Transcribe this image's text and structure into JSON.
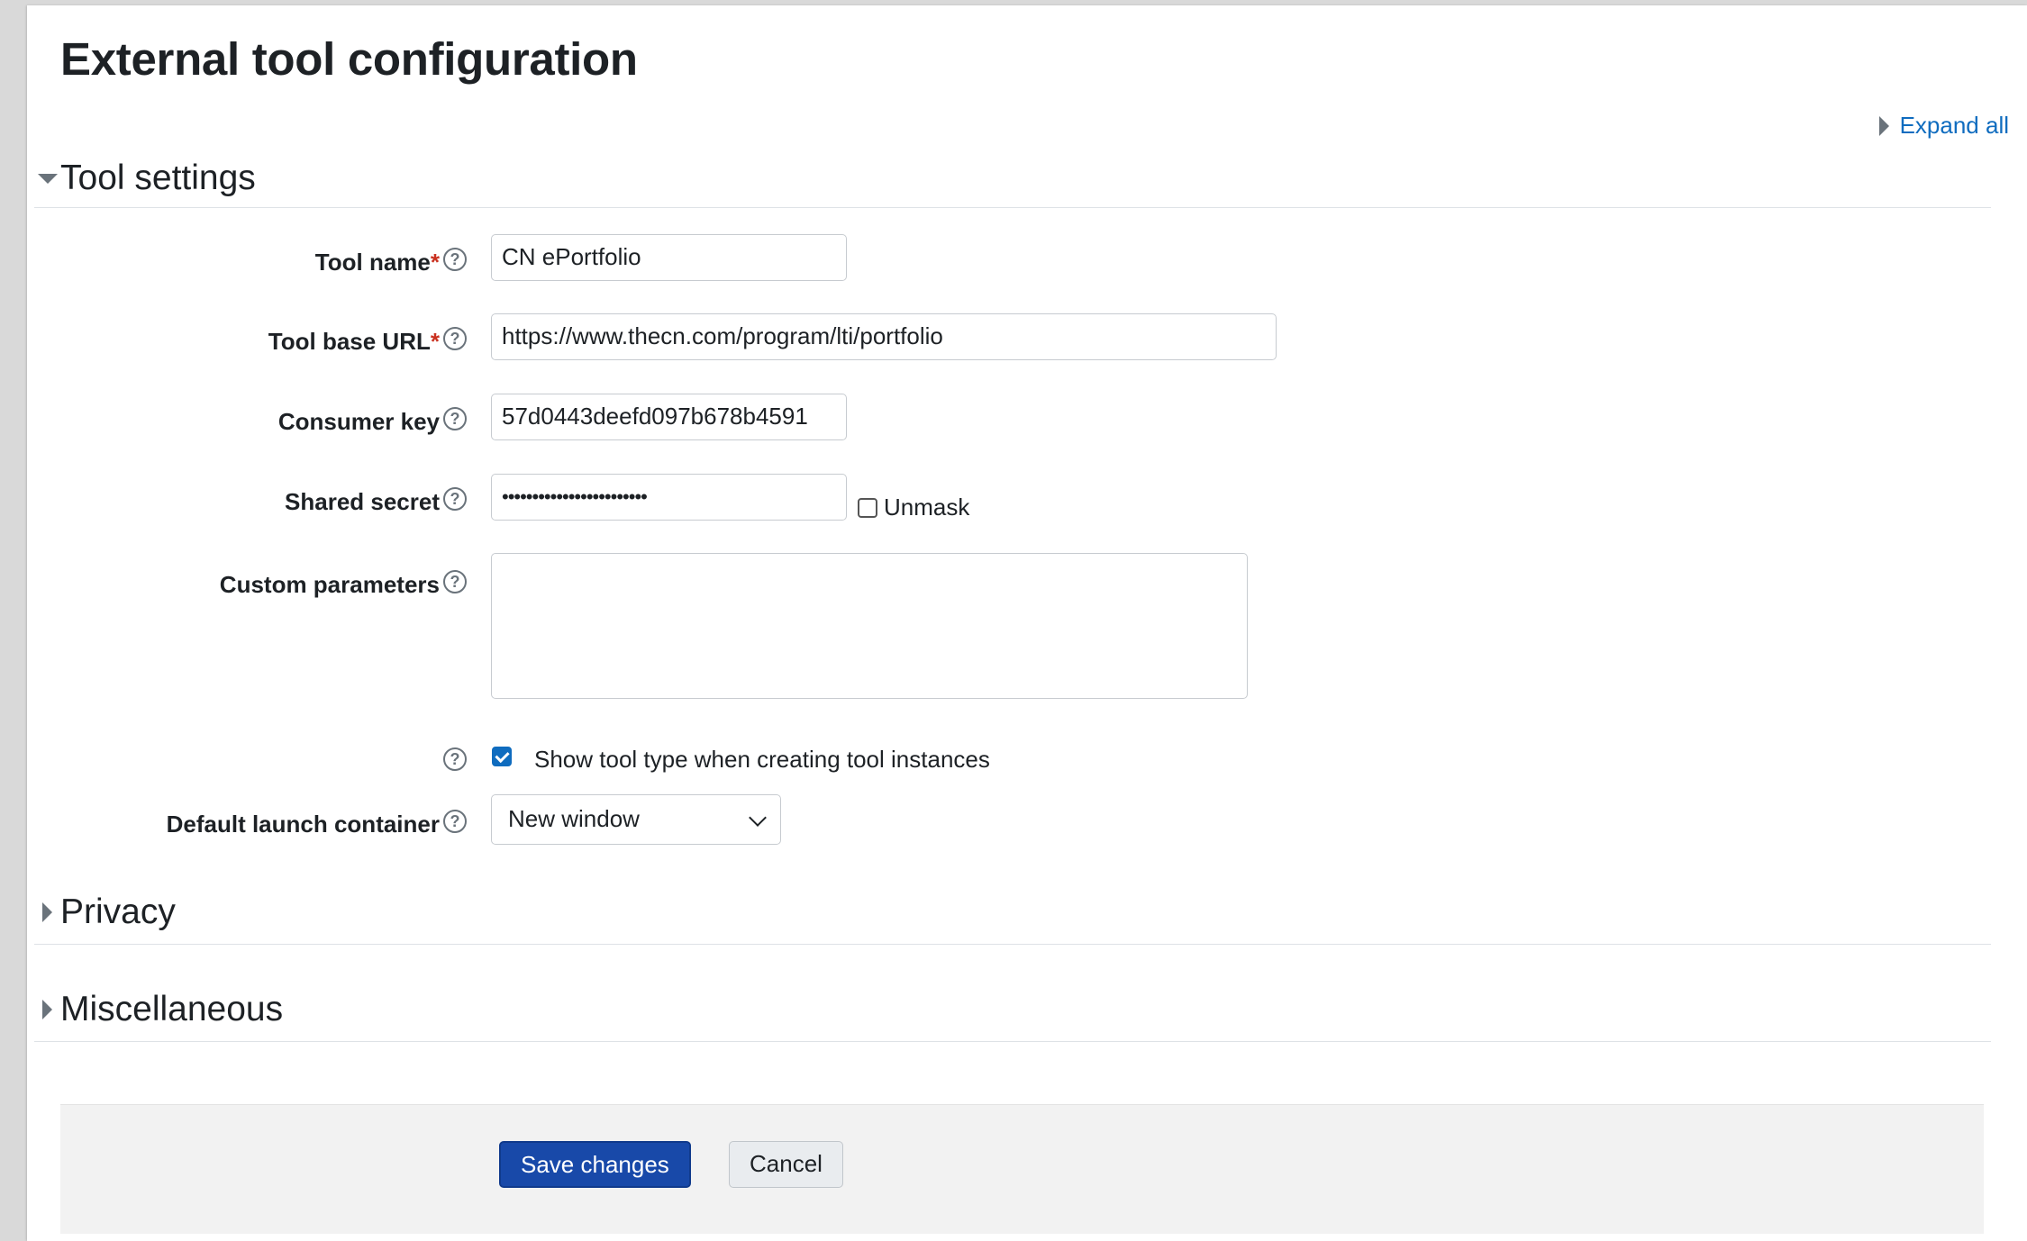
{
  "page": {
    "title": "External tool configuration",
    "expand_all": "Expand all"
  },
  "sections": {
    "tool_settings": "Tool settings",
    "privacy": "Privacy",
    "miscellaneous": "Miscellaneous"
  },
  "form": {
    "tool_name": {
      "label": "Tool name",
      "required_mark": "*",
      "value": "CN ePortfolio"
    },
    "tool_base_url": {
      "label": "Tool base URL",
      "required_mark": "*",
      "value": "https://www.thecn.com/program/lti/portfolio"
    },
    "consumer_key": {
      "label": "Consumer key",
      "value": "57d0443deefd097b678b4591"
    },
    "shared_secret": {
      "label": "Shared secret",
      "value": "••••••••••••••••••••••••",
      "unmask_label": "Unmask",
      "unmask_checked": false
    },
    "custom_parameters": {
      "label": "Custom parameters",
      "value": ""
    },
    "show_tool_type": {
      "label": "Show tool type when creating tool instances",
      "checked": true
    },
    "default_launch_container": {
      "label": "Default launch container",
      "selected": "New window"
    }
  },
  "help_icon_glyph": "?",
  "icons": {
    "help": "question-circle-icon",
    "expand": "caret-right-icon",
    "collapse": "caret-down-icon",
    "dropdown": "chevron-down-icon"
  },
  "buttons": {
    "save": "Save changes",
    "cancel": "Cancel"
  },
  "colors": {
    "link": "#0f6cbf",
    "required": "#ca3120",
    "primary_button": "#1849a9",
    "checkbox_checked": "#0f6cbf"
  }
}
